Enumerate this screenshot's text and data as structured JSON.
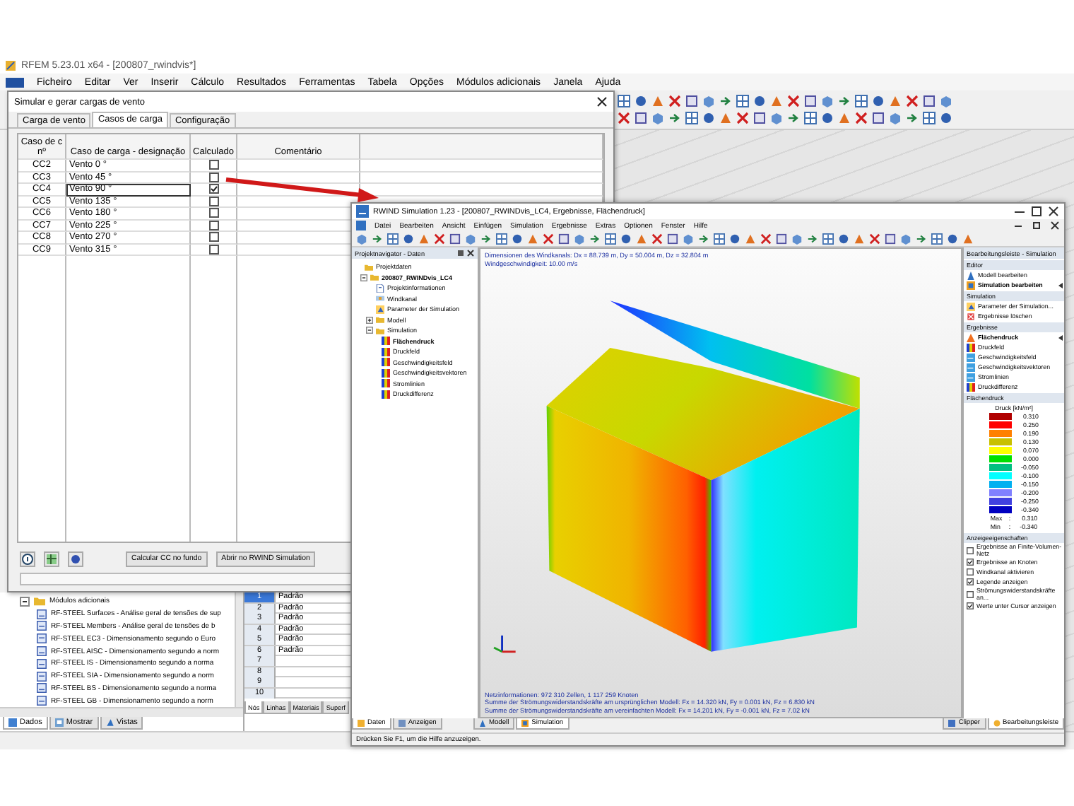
{
  "rfem": {
    "title": "RFEM 5.23.01 x64 - [200807_rwindvis*]",
    "menu": [
      "Ficheiro",
      "Editar",
      "Ver",
      "Inserir",
      "Cálculo",
      "Resultados",
      "Ferramentas",
      "Tabela",
      "Opções",
      "Módulos adicionais",
      "Janela",
      "Ajuda"
    ],
    "navigator": {
      "group": "Módulos adicionais",
      "expanded": true,
      "items": [
        "RF-STEEL Surfaces - Análise geral de tensões de sup",
        "RF-STEEL Members - Análise geral de tensões de b",
        "RF-STEEL EC3 - Dimensionamento segundo o Euro",
        "RF-STEEL AISC - Dimensionamento segundo a norm",
        "RF-STEEL IS - Dimensionamento segundo a norma",
        "RF-STEEL SIA - Dimensionamento segundo a norm",
        "RF-STEEL BS - Dimensionamento segundo a norma",
        "RF-STEEL GB - Dimensionamento segundo a norm"
      ],
      "tabs": [
        {
          "label": "Dados",
          "selected": true
        },
        {
          "label": "Mostrar",
          "selected": false
        },
        {
          "label": "Vistas",
          "selected": false
        }
      ]
    },
    "table": {
      "rows": [
        {
          "number": "1",
          "value": "Padrão",
          "selected": true
        },
        {
          "number": "2",
          "value": "Padrão",
          "selected": false
        },
        {
          "number": "3",
          "value": "Padrão",
          "selected": false
        },
        {
          "number": "4",
          "value": "Padrão",
          "selected": false
        },
        {
          "number": "5",
          "value": "Padrão",
          "selected": false
        },
        {
          "number": "6",
          "value": "Padrão",
          "selected": false
        },
        {
          "number": "7",
          "selected": false
        },
        {
          "number": "8",
          "selected": false
        },
        {
          "number": "9",
          "selected": false
        },
        {
          "number": "10",
          "selected": false
        }
      ],
      "tabs": [
        {
          "label": "Nós",
          "selected": true
        },
        {
          "label": "Linhas",
          "selected": false
        },
        {
          "label": "Materiais",
          "selected": false
        },
        {
          "label": "Superf",
          "selected": false
        }
      ]
    }
  },
  "wind_dialog": {
    "title": "Simular e gerar cargas de vento",
    "tabs": [
      {
        "label": "Carga de vento",
        "selected": false
      },
      {
        "label": "Casos de carga",
        "selected": true
      },
      {
        "label": "Configuração",
        "selected": false
      }
    ],
    "columns": [
      "Caso de c nº",
      "Caso de carga - designação",
      "Calculado",
      "Comentário"
    ],
    "rows": [
      {
        "number": "CC2",
        "name": "Vento 0 °",
        "calculated": false,
        "selected": false
      },
      {
        "number": "CC3",
        "name": "Vento 45 °",
        "calculated": false,
        "selected": false
      },
      {
        "number": "CC4",
        "name": "Vento 90 °",
        "calculated": true,
        "selected": true
      },
      {
        "number": "CC5",
        "name": "Vento 135 °",
        "calculated": false,
        "selected": false
      },
      {
        "number": "CC6",
        "name": "Vento 180 °",
        "calculated": false,
        "selected": false
      },
      {
        "number": "CC7",
        "name": "Vento 225 °",
        "calculated": false,
        "selected": false
      },
      {
        "number": "CC8",
        "name": "Vento 270 °",
        "calculated": false,
        "selected": false
      },
      {
        "number": "CC9",
        "name": "Vento 315 °",
        "calculated": false,
        "selected": false
      }
    ],
    "buttons": [
      "Calcular CC no fundo",
      "Abrir no RWIND Simulation"
    ]
  },
  "rwind": {
    "title": "RWIND Simulation 1.23 - [200807_RWINDvis_LC4, Ergebnisse, Flächendruck]",
    "menu": [
      "Datei",
      "Bearbeiten",
      "Ansicht",
      "Einfügen",
      "Simulation",
      "Ergebnisse",
      "Extras",
      "Optionen",
      "Fenster",
      "Hilfe"
    ],
    "navigator": {
      "title": "Projektnavigator - Daten",
      "tree": [
        {
          "label": "Projektdaten",
          "kind": "folder",
          "active": false,
          "children": [
            {
              "label": "200807_RWINDvis_LC4",
              "kind": "folder",
              "active": true,
              "expanded": true,
              "children": [
                {
                  "label": "Projektinformationen",
                  "kind": "info",
                  "active": false
                },
                {
                  "label": "Windkanal",
                  "kind": "tunnel",
                  "active": false
                },
                {
                  "label": "Parameter der Simulation",
                  "kind": "parameters",
                  "active": false
                },
                {
                  "label": "Modell",
                  "kind": "folder",
                  "active": false,
                  "expanded": false
                },
                {
                  "label": "Simulation",
                  "kind": "folder",
                  "active": false,
                  "expanded": true,
                  "children": [
                    {
                      "label": "Flächendruck",
                      "kind": "result",
                      "active": true
                    },
                    {
                      "label": "Druckfeld",
                      "kind": "result",
                      "active": false
                    },
                    {
                      "label": "Geschwindigkeitsfeld",
                      "kind": "result",
                      "active": false
                    },
                    {
                      "label": "Geschwindigkeitsvektoren",
                      "kind": "result",
                      "active": false
                    },
                    {
                      "label": "Stromlinien",
                      "kind": "result",
                      "active": false
                    },
                    {
                      "label": "Druckdifferenz",
                      "kind": "result",
                      "active": false
                    }
                  ]
                }
              ]
            }
          ]
        }
      ],
      "tabs": [
        {
          "label": "Daten",
          "selected": true
        },
        {
          "label": "Anzeigen",
          "selected": false
        }
      ]
    },
    "viewport": {
      "info": [
        "Dimensionen des Windkanals: Dx = 88.739 m, Dy = 50.004 m, Dz = 32.804 m",
        "Windgeschwindigkeit: 10.00 m/s"
      ],
      "results": [
        "Netzinformationen: 972 310 Zellen, 1 117 259 Knoten",
        "Summe der Strömungswiderstandskräfte am ursprünglichen Modell: Fx = 14.320 kN, Fy = 0.001 kN, Fz = 6.830 kN",
        "Summe der Strömungswiderstandskräfte am vereinfachten Modell: Fx = 14.201 kN, Fy = -0.001 kN, Fz = 7.02 kN"
      ],
      "tabs": [
        {
          "label": "Modell",
          "selected": false
        },
        {
          "label": "Simulation",
          "selected": true
        }
      ]
    },
    "panel": {
      "title": "Bearbeitungsleiste - Simulation",
      "sections": [
        {
          "title": "Editor",
          "items": [
            {
              "label": "Modell bearbeiten",
              "kind": "model",
              "active": false
            },
            {
              "label": "Simulation bearbeiten",
              "kind": "simulation",
              "active": true
            }
          ]
        },
        {
          "title": "Simulation",
          "items": [
            {
              "label": "Parameter der Simulation...",
              "kind": "parameters",
              "active": false
            },
            {
              "label": "Ergebnisse löschen",
              "kind": "delete",
              "active": false
            }
          ]
        },
        {
          "title": "Ergebnisse",
          "items": [
            {
              "label": "Flächendruck",
              "kind": "pressure",
              "active": true
            },
            {
              "label": "Druckfeld",
              "kind": "result",
              "active": false
            },
            {
              "label": "Geschwindigkeitsfeld",
              "kind": "velocity",
              "active": false
            },
            {
              "label": "Geschwindigkeitsvektoren",
              "kind": "velocity",
              "active": false
            },
            {
              "label": "Stromlinien",
              "kind": "velocity",
              "active": false
            },
            {
              "label": "Druckdifferenz",
              "kind": "result",
              "active": false
            }
          ]
        }
      ],
      "legend": {
        "title": "Flächendruck",
        "unit": "Druck [kN/m²]",
        "levels": [
          {
            "value": "0.310",
            "color": "#b00000"
          },
          {
            "value": "0.250",
            "color": "#ff0000"
          },
          {
            "value": "0.190",
            "color": "#ff8000"
          },
          {
            "value": "0.130",
            "color": "#c8c000"
          },
          {
            "value": "0.070",
            "color": "#ffff00"
          },
          {
            "value": "0.000",
            "color": "#00e000"
          },
          {
            "value": "-0.050",
            "color": "#00c080"
          },
          {
            "value": "-0.100",
            "color": "#00ffff"
          },
          {
            "value": "-0.150",
            "color": "#00b0f0"
          },
          {
            "value": "-0.200",
            "color": "#8080ff"
          },
          {
            "value": "-0.250",
            "color": "#4040e0"
          },
          {
            "value": "-0.340",
            "color": "#0000c0"
          }
        ],
        "max": {
          "label": "Max",
          "separator": ":",
          "value": "0.310"
        },
        "min": {
          "label": "Min",
          "separator": ":",
          "value": "-0.340"
        }
      },
      "display": {
        "title": "Anzeigeeigenschaften",
        "options": [
          {
            "label": "Ergebnisse an Finite-Volumen-Netz",
            "checked": false
          },
          {
            "label": "Ergebnisse an Knoten",
            "checked": true
          },
          {
            "label": "Windkanal aktivieren",
            "checked": false
          },
          {
            "label": "Legende anzeigen",
            "checked": true
          },
          {
            "label": "Strömungswiderstandskräfte an...",
            "checked": false
          },
          {
            "label": "Werte unter Cursor anzeigen",
            "checked": true
          }
        ]
      },
      "tabs": [
        {
          "label": "Clipper",
          "selected": false
        },
        {
          "label": "Bearbeitungsleiste",
          "selected": true
        }
      ]
    },
    "status": "Drücken Sie F1, um die Hilfe anzuzeigen."
  }
}
